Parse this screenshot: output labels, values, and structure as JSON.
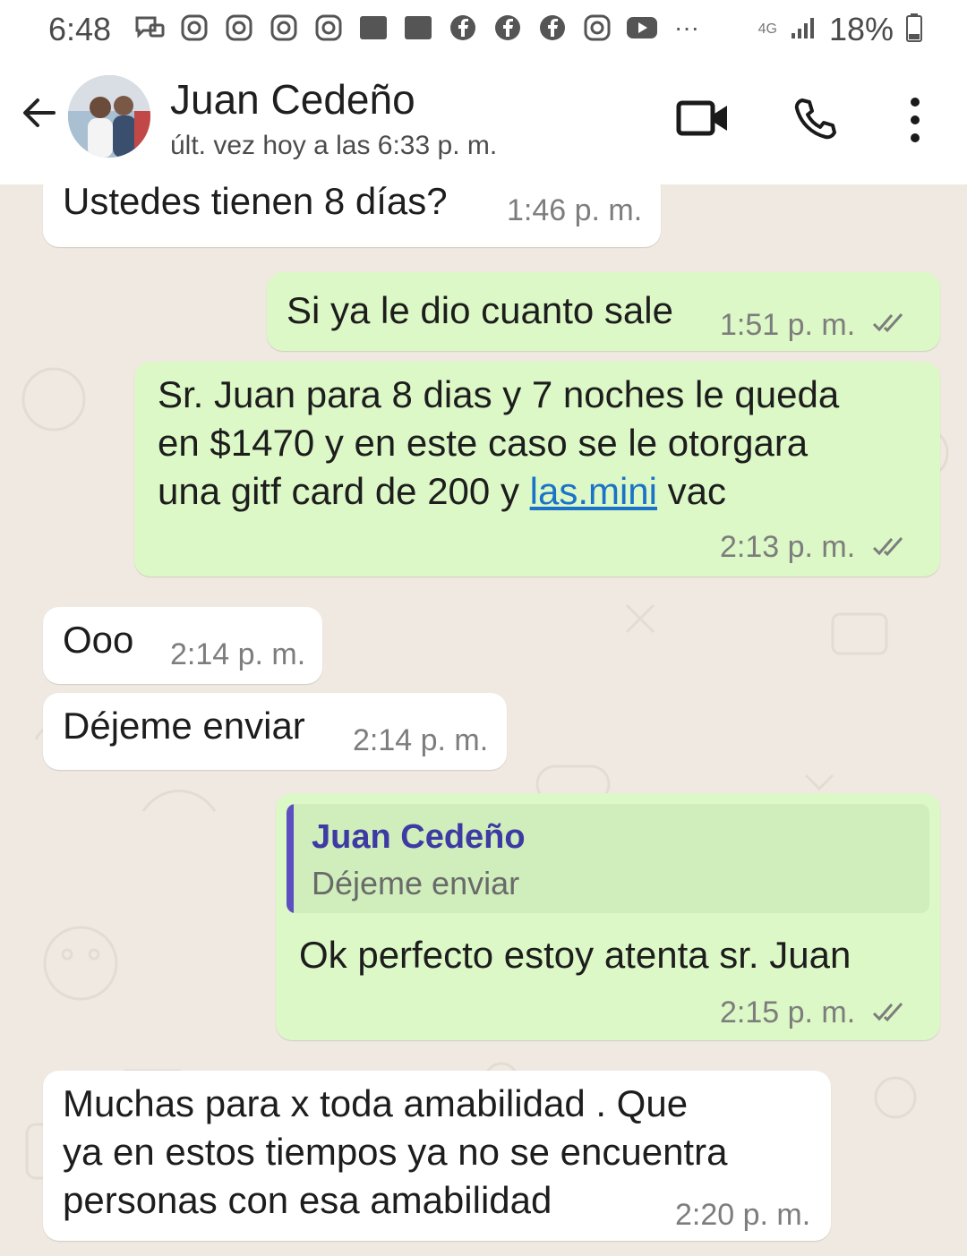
{
  "status_bar": {
    "time": "6:48",
    "battery": "18%",
    "network": "4G",
    "more": "···",
    "icons": [
      "message-icon",
      "instagram-icon",
      "instagram-icon",
      "instagram-icon",
      "instagram-icon",
      "app-icon",
      "app-icon",
      "facebook-icon",
      "facebook-icon",
      "facebook-icon",
      "instagram-icon",
      "youtube-icon"
    ]
  },
  "header": {
    "contact_name": "Juan Cedeño",
    "last_seen": "últ. vez hoy a las 6:33 p. m."
  },
  "messages": [
    {
      "direction": "in",
      "text": "Ustedes tienen 8 días?",
      "time": "1:46 p. m."
    },
    {
      "direction": "out",
      "text": "Si ya le dio cuanto sale",
      "time": "1:51 p. m."
    },
    {
      "direction": "out",
      "lines": [
        "Sr. Juan para 8 dias y 7 noches le queda",
        "en $1470 y en este caso se le otorgara",
        "una gitf card de 200 y "
      ],
      "link": "las.mini",
      "after_link": " vac",
      "time": "2:13 p. m."
    },
    {
      "direction": "in",
      "text": "Ooo",
      "time": "2:14 p. m."
    },
    {
      "direction": "in",
      "text": "Déjeme enviar",
      "time": "2:14 p. m."
    },
    {
      "direction": "out",
      "quote": {
        "author": "Juan Cedeño",
        "text": "Déjeme enviar"
      },
      "text": "Ok perfecto estoy atenta sr. Juan",
      "time": "2:15 p. m."
    },
    {
      "direction": "in",
      "lines": [
        "Muchas para x toda amabilidad . Que",
        "ya en estos tiempos ya no se encuentra",
        "personas con esa  amabilidad"
      ],
      "time": "2:20 p. m."
    }
  ],
  "colors": {
    "outgoing_bubble": "#dcf8c6",
    "incoming_bubble": "#ffffff",
    "chat_background": "#efe9e1",
    "quote_bar": "#5b4fc2",
    "link": "#1a73c8"
  }
}
